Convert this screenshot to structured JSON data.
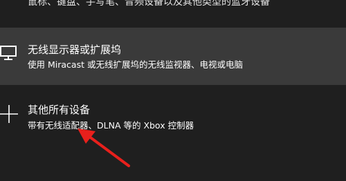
{
  "top_item": {
    "description_partial": "鼠标、键盘、手写笔、音频设备以及其他类型的蓝牙设备"
  },
  "options": [
    {
      "title": "无线显示器或扩展坞",
      "description": "使用 Miracast 或无线扩展坞的无线监视器、电视或电脑",
      "icon": "monitor-icon"
    },
    {
      "title": "其他所有设备",
      "description": "带有无线适配器、DLNA 等的 Xbox 控制器",
      "icon": "plus-icon"
    }
  ],
  "colors": {
    "background": "#1f1f1f",
    "highlight": "#3a3a3a",
    "text": "#ffffff",
    "annotation_arrow": "#e8201c"
  }
}
